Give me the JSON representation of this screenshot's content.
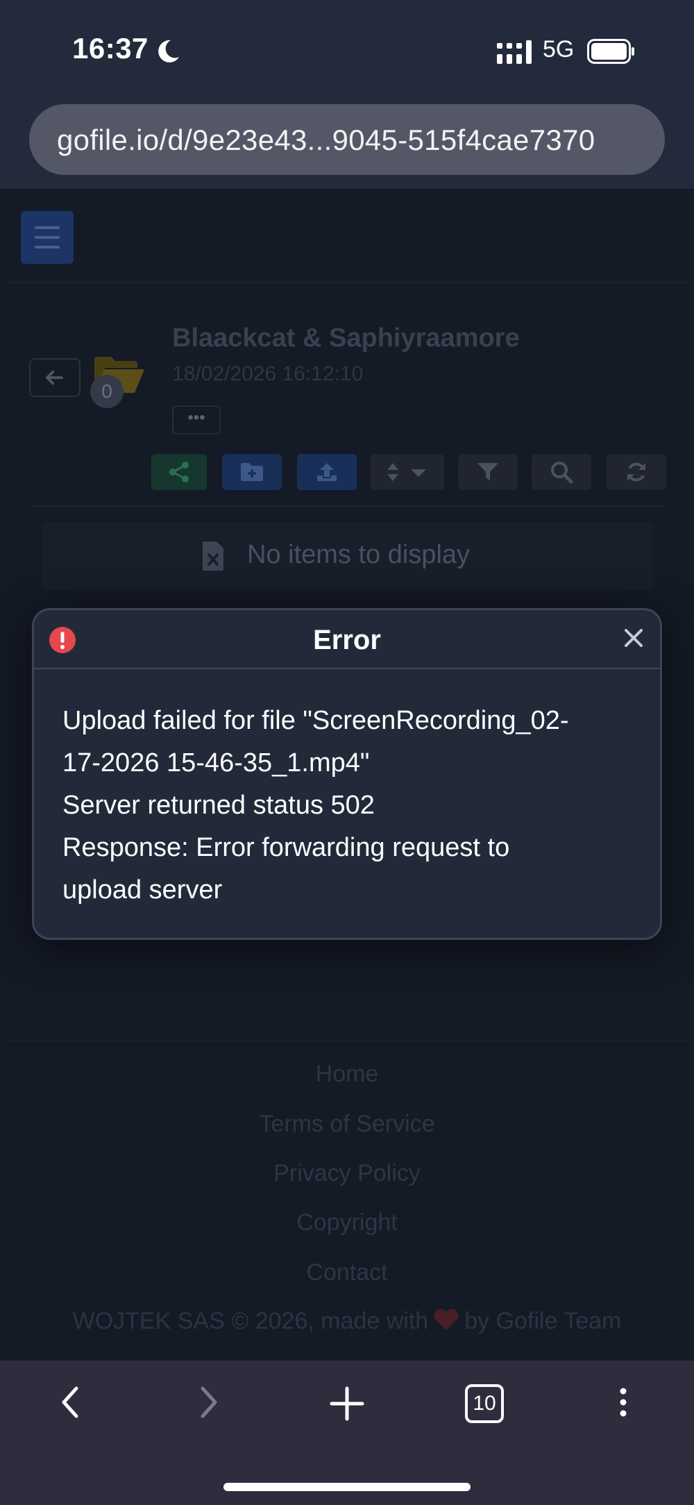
{
  "status_bar": {
    "time": "16:37",
    "network": "5G",
    "icons": [
      "moon-icon",
      "signal-icon",
      "battery-icon"
    ]
  },
  "browser": {
    "url": "gofile.io/d/9e23e43...9045-515f4cae7370",
    "tab_count": "10",
    "toolbar_icons": [
      "back-icon",
      "forward-icon",
      "new-tab-icon",
      "tabs-icon",
      "more-icon"
    ]
  },
  "folder": {
    "name": "Blaackcat & Saphiyraamore",
    "date": "18/02/2026 16:12:10",
    "item_count": "0",
    "more_label": "•••",
    "toolbar_icons": [
      "share-icon",
      "new-folder-icon",
      "upload-icon",
      "sort-icon",
      "filter-icon",
      "search-icon",
      "refresh-icon"
    ]
  },
  "empty_state": {
    "text": "No items to display"
  },
  "modal": {
    "title": "Error",
    "lines": [
      "Upload failed for file \"ScreenRecording_02-",
      "17-2026 15-46-35_1.mp4\"",
      "Server returned status 502",
      "Response: Error forwarding request to",
      "upload server"
    ]
  },
  "footer": {
    "links": [
      "Home",
      "Terms of Service",
      "Privacy Policy",
      "Copyright",
      "Contact"
    ],
    "copyright_prefix": "WOJTEK SAS © 2026, made with",
    "copyright_suffix": "by Gofile Team"
  },
  "colors": {
    "page_bg": "#141a26",
    "modal_bg": "#222a3a",
    "error_red": "#e5484d",
    "bottom_bar": "#2f2c3d"
  }
}
